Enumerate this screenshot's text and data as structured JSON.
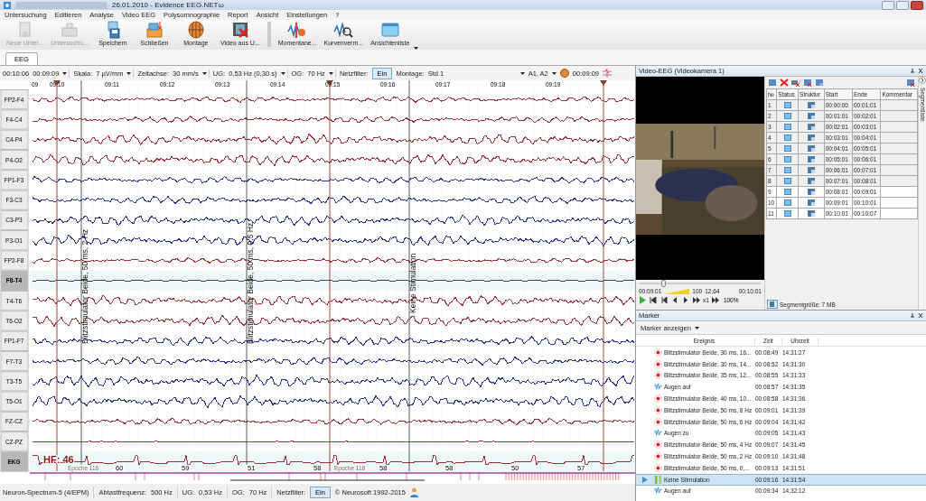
{
  "window": {
    "title": "26.01.2010 - Evidence EEG.NETω"
  },
  "menu": [
    "Untersuchung",
    "Editieren",
    "Analyse",
    "Video EEG",
    "Polysomnographie",
    "Report",
    "Ansicht",
    "Einstellungen",
    "?"
  ],
  "toolbar": [
    {
      "label": "Neue Unter...",
      "kind": "new",
      "disabled": true
    },
    {
      "label": "Untersuchu...",
      "kind": "exam",
      "disabled": true
    },
    {
      "label": "Speichern",
      "kind": "save",
      "disabled": false
    },
    {
      "label": "Schließen",
      "kind": "close",
      "disabled": false
    },
    {
      "label": "Montage",
      "kind": "montage",
      "disabled": false
    },
    {
      "label": "Video aus U...",
      "kind": "video",
      "disabled": false
    },
    {
      "label": "Momentane...",
      "kind": "wave",
      "disabled": false
    },
    {
      "label": "Kurvenverm...",
      "kind": "measure",
      "disabled": false
    },
    {
      "label": "Ansichtenliste",
      "kind": "views",
      "disabled": false
    }
  ],
  "tabs": [
    {
      "label": "EEG",
      "selected": true
    }
  ],
  "eeg_toolbar": {
    "time": "00:10:06",
    "position": "00:09:09",
    "scale_label": "Skala:",
    "scale": "7 µV/mm",
    "timebase_label": "Zeitachse:",
    "timebase": "30 mm/s",
    "lowcut_label": "UG:",
    "lowcut": "0,53 Hz (0,30 s)",
    "highcut_label": "OG:",
    "highcut": "70 Hz",
    "notch_label": "Netzfilter:",
    "notch": "Ein",
    "montage_label": "Montage:",
    "montage": "Std 1",
    "reference": "A1, A2",
    "clock": "00:09:09"
  },
  "eeg": {
    "time_labels": [
      "09",
      "09:10",
      "09:11",
      "09:12",
      "09:13",
      "09:14",
      "09:15",
      "09:16",
      "09:17",
      "09:18",
      "09:19"
    ],
    "channels": [
      {
        "name": "FP2-F4",
        "color": "#a0303a",
        "selected": false
      },
      {
        "name": "F4-C4",
        "color": "#a0303a",
        "selected": false
      },
      {
        "name": "C4-P4",
        "color": "#a0303a",
        "selected": false
      },
      {
        "name": "P4-O2",
        "color": "#a0303a",
        "selected": false
      },
      {
        "name": "FP1-F3",
        "color": "#2a3490",
        "selected": false
      },
      {
        "name": "F3-C3",
        "color": "#2a3490",
        "selected": false
      },
      {
        "name": "C3-P3",
        "color": "#2a3490",
        "selected": false
      },
      {
        "name": "P3-O1",
        "color": "#2a3490",
        "selected": false
      },
      {
        "name": "FP2-F8",
        "color": "#a0303a",
        "selected": false
      },
      {
        "name": "F8-T4",
        "color": "#404040",
        "selected": true
      },
      {
        "name": "T4-T6",
        "color": "#a0303a",
        "selected": false
      },
      {
        "name": "T6-O2",
        "color": "#a0303a",
        "selected": false
      },
      {
        "name": "FP1-F7",
        "color": "#2a3490",
        "selected": false
      },
      {
        "name": "F7-T3",
        "color": "#2a3490",
        "selected": false
      },
      {
        "name": "T3-T5",
        "color": "#2a3490",
        "selected": false
      },
      {
        "name": "T5-O1",
        "color": "#2a3490",
        "selected": false
      },
      {
        "name": "FZ-CZ",
        "color": "#a0303a",
        "selected": false
      },
      {
        "name": "CZ-PZ",
        "color": "#a0303a",
        "selected": false
      },
      {
        "name": "EKG",
        "color": "#a0303a",
        "selected": true
      }
    ],
    "annotations": [
      "Blitzstimulator Beide, 50 ms, 2 Hz",
      "Blitzstimulator Beide, 50 ms, 0,5 Hz",
      "Keine Stimulation"
    ],
    "heart_rate": "HF: 46",
    "beat_rates": [
      "60",
      "59",
      "51",
      "58",
      "58",
      "58",
      "50",
      "57"
    ],
    "epochs": [
      "Epoche 116",
      "Epoche 118"
    ]
  },
  "status_bar": {
    "device": "Neuron-Spectrum-5 (4/EPM)",
    "rate_label": "Abtastfrequenz:",
    "rate": "500 Hz",
    "lowcut_label": "UG:",
    "lowcut": "0,53 Hz",
    "highcut_label": "OG:",
    "highcut": "70 Hz",
    "notch_label": "Netzfilter:",
    "notch": "Ein",
    "copyright": "© Neurosoft 1992-2015"
  },
  "video": {
    "title": "Video-EEG (Videokamera 1)",
    "seek": {
      "level": 0.2
    },
    "start": "00:09:01",
    "volume": "100",
    "time": "12,64",
    "end": "00:10:01",
    "speed": "x1",
    "zoom": "100%",
    "segment_size": "Segmentgröße: 7 MB",
    "segment_tab": "Segmentliste",
    "segment_columns": [
      "№",
      "Status",
      "Struktur",
      "Start",
      "Ende",
      "Kommentar"
    ],
    "segments": [
      {
        "no": "1",
        "start": "00:00:00",
        "end": "00:01:01"
      },
      {
        "no": "2",
        "start": "00:01:01",
        "end": "00:02:01"
      },
      {
        "no": "3",
        "start": "00:02:01",
        "end": "00:03:01"
      },
      {
        "no": "4",
        "start": "00:03:01",
        "end": "00:04:01"
      },
      {
        "no": "5",
        "start": "00:04:01",
        "end": "00:05:01"
      },
      {
        "no": "6",
        "start": "00:05:01",
        "end": "00:06:01"
      },
      {
        "no": "7",
        "start": "00:06:01",
        "end": "00:07:01"
      },
      {
        "no": "8",
        "start": "00:07:01",
        "end": "00:08:01"
      },
      {
        "no": "9",
        "start": "00:08:01",
        "end": "00:09:01"
      },
      {
        "no": "10",
        "start": "00:09:01",
        "end": "00:10:01"
      },
      {
        "no": "11",
        "start": "00:10:01",
        "end": "00:10:07"
      }
    ]
  },
  "marker": {
    "title": "Marker",
    "filter": "Marker anzeigen",
    "columns": [
      "Ereignis",
      "Zeit",
      "Uhrzeit"
    ],
    "rows": [
      {
        "kind": "flash",
        "event": "Blitzstimulator Beide, 30 ms, 16...",
        "time": "00:08:49",
        "clock": "14:31:27",
        "selected": false
      },
      {
        "kind": "flash",
        "event": "Blitzstimulator Beide, 30 ms, 14...",
        "time": "00:08:52",
        "clock": "14:31:30",
        "selected": false
      },
      {
        "kind": "flash",
        "event": "Blitzstimulator Beide, 35 ms, 12...",
        "time": "00:08:55",
        "clock": "14:31:33",
        "selected": false
      },
      {
        "kind": "eyes",
        "event": "Augen auf",
        "time": "00:08:57",
        "clock": "14:31:35",
        "selected": false
      },
      {
        "kind": "flash",
        "event": "Blitzstimulator Beide, 40 ms, 10...",
        "time": "00:08:58",
        "clock": "14:31:36",
        "selected": false
      },
      {
        "kind": "flash",
        "event": "Blitzstimulator Beide, 50 ms, 8 Hz",
        "time": "00:09:01",
        "clock": "14:31:39",
        "selected": false
      },
      {
        "kind": "flash",
        "event": "Blitzstimulator Beide, 50 ms, 6 Hz",
        "time": "00:09:04",
        "clock": "14:31:42",
        "selected": false
      },
      {
        "kind": "eyes",
        "event": "Augen zu",
        "time": "00:09:05",
        "clock": "14:31:43",
        "selected": false
      },
      {
        "kind": "flash",
        "event": "Blitzstimulator Beide, 50 ms, 4 Hz",
        "time": "00:09:07",
        "clock": "14:31:45",
        "selected": false
      },
      {
        "kind": "flash",
        "event": "Blitzstimulator Beide, 50 ms, 2 Hz",
        "time": "00:09:10",
        "clock": "14:31:48",
        "selected": false
      },
      {
        "kind": "flash",
        "event": "Blitzstimulator Beide, 50 ms, 0,...",
        "time": "00:09:13",
        "clock": "14:31:51",
        "selected": false
      },
      {
        "kind": "pause",
        "event": "Keine Stimulation",
        "time": "00:09:16",
        "clock": "14:31:54",
        "selected": true
      },
      {
        "kind": "eyes",
        "event": "Augen auf",
        "time": "00:09:34",
        "clock": "14:32:12",
        "selected": false
      }
    ]
  }
}
